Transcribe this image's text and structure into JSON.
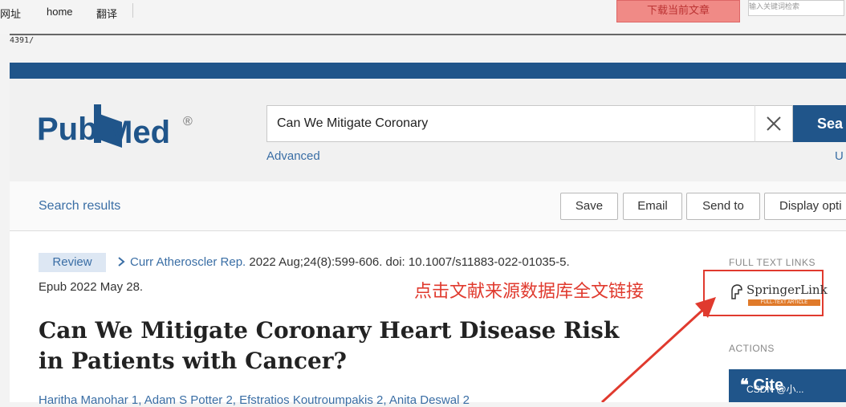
{
  "browser": {
    "nav_items": [
      "网址",
      "home",
      "翻译"
    ],
    "download_button": "下载当前文章",
    "mini_input_text": "输入关键词检索",
    "url_fragment": "4391/"
  },
  "header": {
    "logo_text_pub": "Pub",
    "logo_text_med": "Med",
    "logo_reg": "®",
    "search_value": "Can We Mitigate Coronary",
    "search_button": "Sea",
    "advanced_link": "Advanced",
    "user_link": "U"
  },
  "toolbar": {
    "search_results": "Search results",
    "buttons": [
      "Save",
      "Email",
      "Send to",
      "Display opti"
    ]
  },
  "article": {
    "type_badge": "Review",
    "journal": "Curr Atheroscler Rep.",
    "citation_rest": " 2022 Aug;24(8):599-606. doi: 10.1007/s11883-022-01035-5.",
    "epub": "Epub 2022 May 28.",
    "title": "Can We Mitigate Coronary Heart Disease Risk in Patients with Cancer?",
    "authors": "Haritha Manohar 1, Adam S Potter 2, Efstratios Koutroumpakis 2, Anita Deswal 2"
  },
  "sidebar": {
    "full_text_label": "FULL TEXT LINKS",
    "springer_label": "SpringerLink",
    "springer_sub": "FULL-TEXT ARTICLE",
    "actions_label": "ACTIONS",
    "cite_label": "❝ Cite"
  },
  "annotation": {
    "text": "点击文献来源数据库全文链接",
    "color": "#e03a2e"
  },
  "watermark": "CSDN @小..."
}
